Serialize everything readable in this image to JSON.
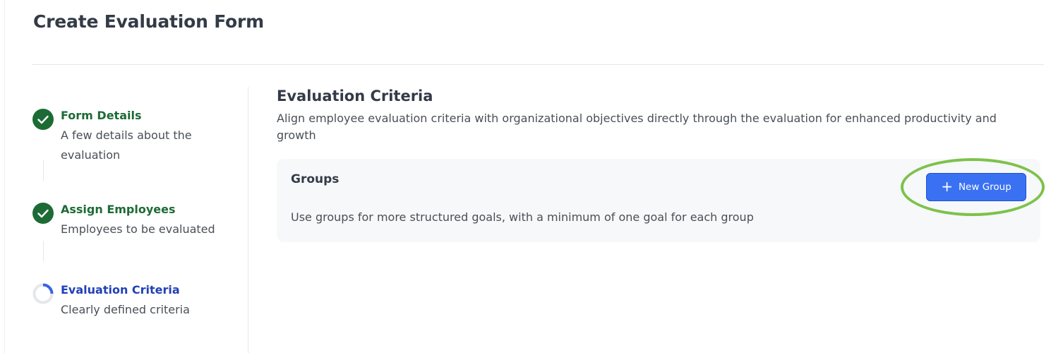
{
  "page": {
    "title": "Create Evaluation Form"
  },
  "stepper": {
    "steps": [
      {
        "title": "Form Details",
        "description": "A few details about the evaluation",
        "status": "completed"
      },
      {
        "title": "Assign Employees",
        "description": "Employees to be evaluated",
        "status": "completed"
      },
      {
        "title": "Evaluation Criteria",
        "description": "Clearly defined criteria",
        "status": "in-progress"
      }
    ]
  },
  "section": {
    "title": "Evaluation Criteria",
    "description": "Align employee evaluation criteria with organizational objectives directly through the evaluation for enhanced productivity and growth"
  },
  "groups": {
    "title": "Groups",
    "description": "Use groups for more structured goals, with a minimum of one goal for each group",
    "new_group_label": "New Group",
    "new_group_icon": "plus-icon"
  },
  "colors": {
    "completed_step": "#1c6b35",
    "active_step": "#2140b8",
    "primary_button": "#3a71f2",
    "highlight_ring": "#7dc24b"
  }
}
